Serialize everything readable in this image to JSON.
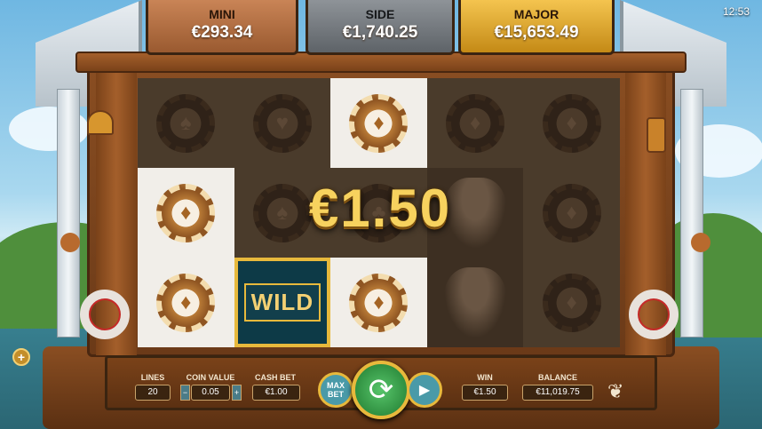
{
  "jackpots": {
    "mini": {
      "label": "MINI",
      "value": "€293.34"
    },
    "side": {
      "label": "SIDE",
      "value": "€1,740.25"
    },
    "major": {
      "label": "MAJOR",
      "value": "€15,653.49"
    }
  },
  "clock": "12:53",
  "win_display": "€1.50",
  "wild_label": "WILD",
  "controls": {
    "lines_label": "LINES",
    "lines_value": "20",
    "coin_value_label": "COIN VALUE",
    "coin_value": "0.05",
    "cash_bet_label": "CASH BET",
    "cash_bet_value": "€1.00",
    "max_bet_label": "MAX BET",
    "win_label": "WIN",
    "win_value": "€1.50",
    "balance_label": "BALANCE",
    "balance_value": "€11,019.75"
  },
  "reels": [
    [
      "spade",
      "diamond",
      "diamond"
    ],
    [
      "heart",
      "spade",
      "wild"
    ],
    [
      "diamond",
      "club",
      "diamond"
    ],
    [
      "diamond",
      "agent",
      "agent"
    ],
    [
      "diamond",
      "diamond",
      "diamond"
    ]
  ],
  "highlighted_cells": [
    "r0c2",
    "r1c0",
    "r2c0",
    "r2c1",
    "r2c2"
  ],
  "colors": {
    "gold": "#e8b93c",
    "wood": "#7a4219",
    "spin_green": "#1f7a2f"
  }
}
